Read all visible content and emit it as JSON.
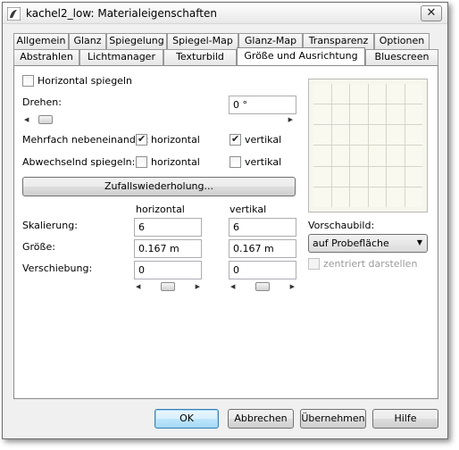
{
  "window": {
    "title": "kachel2_low: Materialeigenschaften",
    "close_glyph": "✕"
  },
  "tabs_row1": [
    "Allgemein",
    "Glanz",
    "Spiegelung",
    "Spiegel-Map",
    "Glanz-Map",
    "Transparenz",
    "Optionen"
  ],
  "tabs_row2": [
    "Abstrahlen",
    "Lichtmanager",
    "Texturbild",
    "Größe und Ausrichtung",
    "Bluescreen"
  ],
  "active_tab": "Größe und Ausrichtung",
  "panel": {
    "mirror_horizontal": {
      "label": "Horizontal spiegeln",
      "checked": false
    },
    "rotate": {
      "label": "Drehen:",
      "value": "0 °"
    },
    "tile": {
      "label": "Mehrfach nebeneinander:",
      "h_label": "horizontal",
      "h_checked": true,
      "v_label": "vertikal",
      "v_checked": true
    },
    "alt_mirror": {
      "label": "Abwechselnd spiegeln:",
      "h_label": "horizontal",
      "h_checked": false,
      "v_label": "vertikal",
      "v_checked": false
    },
    "random_button": "Zufallswiederholung...",
    "col_horizontal": "horizontal",
    "col_vertikal": "vertikal",
    "scaling": {
      "label": "Skalierung:",
      "h": "6",
      "v": "6"
    },
    "size": {
      "label": "Größe:",
      "h": "0.167 m",
      "v": "0.167 m"
    },
    "offset": {
      "label": "Verschiebung:",
      "h": "0",
      "v": "0"
    },
    "preview_label": "Vorschaubild:",
    "preview_select": "auf Probefläche",
    "center_label": "zentriert darstellen",
    "center_checked": false
  },
  "buttons": {
    "ok": "OK",
    "cancel": "Abbrechen",
    "apply": "Übernehmen",
    "help": "Hilfe"
  },
  "colors": {
    "accent": "#3c7fb1",
    "window_bg": "#f0f0f0",
    "panel_bg": "#ffffff"
  },
  "icons": {
    "app": "app-logo-icon",
    "close": "close-icon",
    "dropdown": "chevron-down-icon"
  }
}
